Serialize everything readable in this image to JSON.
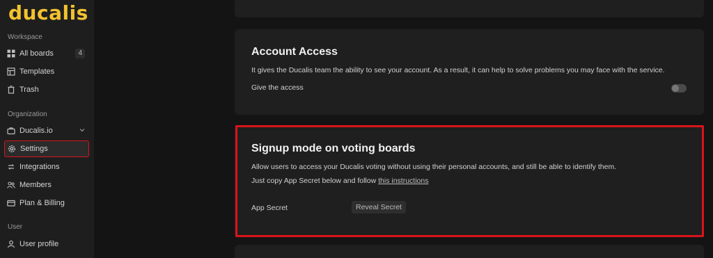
{
  "brand": {
    "logo_text": "ducalis",
    "logo_color": "#f2c230"
  },
  "sidebar": {
    "workspace_title": "Workspace",
    "workspace_items": [
      {
        "label": "All boards",
        "icon": "grid-icon",
        "count": "4"
      },
      {
        "label": "Templates",
        "icon": "template-icon"
      },
      {
        "label": "Trash",
        "icon": "trash-icon"
      }
    ],
    "organization_title": "Organization",
    "organization_items": [
      {
        "label": "Ducalis.io",
        "icon": "briefcase-icon"
      },
      {
        "label": "Settings",
        "icon": "gear-icon",
        "active": true
      },
      {
        "label": "Integrations",
        "icon": "integrations-icon"
      },
      {
        "label": "Members",
        "icon": "members-icon"
      },
      {
        "label": "Plan & Billing",
        "icon": "billing-icon"
      }
    ],
    "user_title": "User",
    "user_items": [
      {
        "label": "User profile",
        "icon": "user-icon"
      }
    ]
  },
  "account_access": {
    "title": "Account Access",
    "description": "It gives the Ducalis team the ability to see your account. As a result, it can help to solve problems you may face with the service.",
    "toggle_label": "Give the access",
    "toggle_on": false
  },
  "signup_mode": {
    "title": "Signup mode on voting boards",
    "description": "Allow users to access your Ducalis voting without using their personal accounts, and still be able to identify them.",
    "instructions_prefix": "Just copy App Secret below and follow ",
    "instructions_link": "this instructions",
    "secret_label": "App Secret",
    "reveal_button": "Reveal Secret"
  },
  "colors": {
    "highlight": "#d9141b",
    "background": "#141414",
    "card": "#1f1f1f",
    "sidebar": "#1e1e1e"
  }
}
